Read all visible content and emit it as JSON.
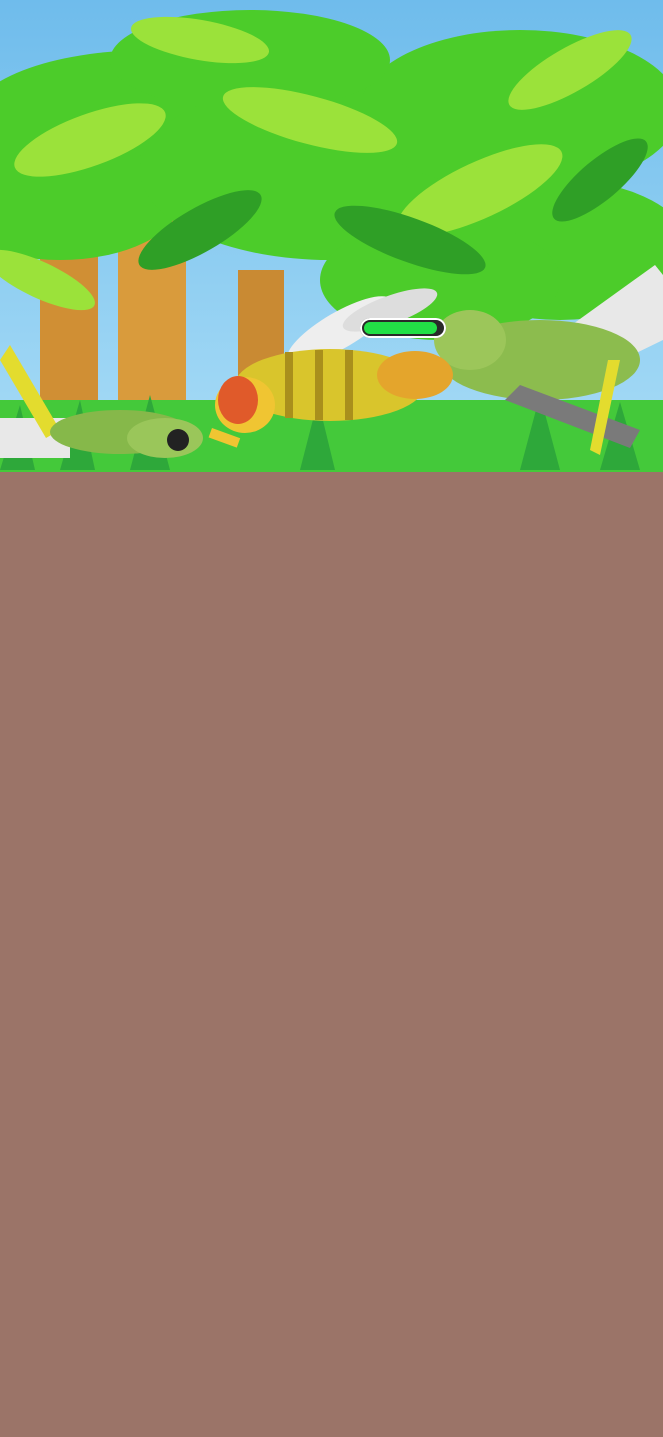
{
  "scene": {
    "sky_color": "#7cc3ee",
    "grass_color": "#4fd33a",
    "soil_color": "#9b7468",
    "tunnel_color": "#ddbb98"
  },
  "enemy": {
    "name": "hornet",
    "health_fraction": 0.93,
    "health_color": "#22e046"
  },
  "colony": {
    "worker_ant_color": "#3bd43a",
    "enemy_ant_color": "#e5161c",
    "queen_color": "#f0196e",
    "soldier_ant_color": "#1b1b1b"
  },
  "markers": {
    "food_marker_icon": "meat-bone-icon",
    "food_marker_color": "#e01b22",
    "storage_icon": "meat-bone-icon"
  },
  "facilities": {
    "dna_lab_icon": "dna-icon",
    "dna_colors": [
      "#e8458d",
      "#3d8fe0"
    ]
  }
}
